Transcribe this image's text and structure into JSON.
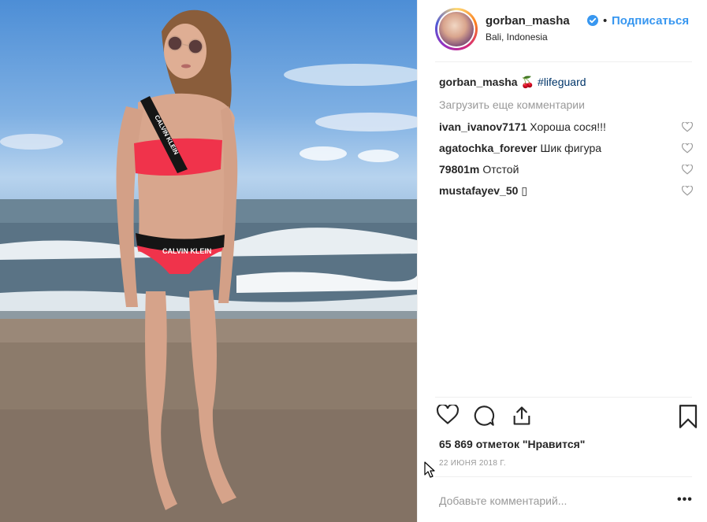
{
  "post": {
    "username": "gorban_masha",
    "follow_label": "Подписаться",
    "dot": "•",
    "location": "Bali, Indonesia",
    "caption_user": "gorban_masha",
    "caption_emoji": "🍒",
    "caption_hashtag": "#lifeguard",
    "load_more": "Загрузить еще комментарии",
    "comments": [
      {
        "user": "ivan_ivanov7171",
        "text": "Хороша сося!!!"
      },
      {
        "user": "agatochka_forever",
        "text": "Шик фигура"
      },
      {
        "user": "79801m",
        "text": "Отстой"
      },
      {
        "user": "mustafayev_50",
        "text": "▯"
      }
    ],
    "likes": "65 869 отметок \"Нравится\"",
    "date": "22 ИЮНЯ 2018 Г.",
    "comment_placeholder": "Добавьте комментарий...",
    "more_label": "•••"
  },
  "photo": {
    "swimsuit_brand_top": "CALVIN KLEIN",
    "swimsuit_brand_bottom": "CALVIN KLEIN"
  },
  "icons": {
    "heart": "heart-icon",
    "comment": "comment-icon",
    "share": "share-icon",
    "bookmark": "bookmark-icon",
    "verified": "verified-badge-icon"
  },
  "colors": {
    "accent": "#3897f0",
    "text": "#262626",
    "muted": "#999999",
    "hashtag": "#003569"
  }
}
